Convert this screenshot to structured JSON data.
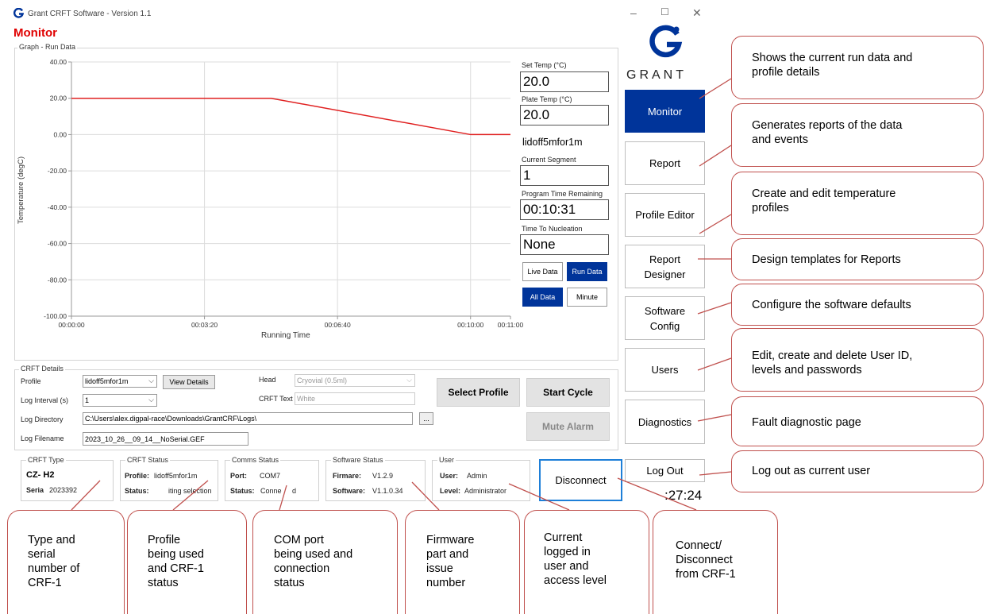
{
  "window": {
    "title": "Grant CRFT Software - Version 1.1",
    "minimize": "–",
    "maximize": "☐",
    "close": "✕"
  },
  "section_title": "Monitor",
  "graph": {
    "group_label": "Graph - Run Data",
    "y_axis_label": "Temperature (degC)",
    "x_axis_label": "Running Time",
    "y_ticks": [
      "40.00",
      "20.00",
      "0.00",
      "-20.00",
      "-40.00",
      "-60.00",
      "-80.00",
      "-100.00"
    ],
    "x_ticks": [
      "00:00:00",
      "00:03:20",
      "00:06:40",
      "00:10:00",
      "00:11:00"
    ]
  },
  "chart_data": {
    "type": "line",
    "xlabel": "Running Time",
    "ylabel": "Temperature (degC)",
    "ylim": [
      -100,
      40
    ],
    "xlim": [
      "00:00:00",
      "00:11:00"
    ],
    "grid": true,
    "series": [
      {
        "color": "#e02020",
        "x": [
          "00:00:00",
          "00:05:00",
          "00:10:00",
          "00:11:00"
        ],
        "y": [
          20,
          20,
          0,
          0
        ]
      }
    ]
  },
  "readouts": {
    "set_temp_label": "Set Temp (°C)",
    "set_temp": "20.0",
    "plate_temp_label": "Plate Temp (°C)",
    "plate_temp": "20.0",
    "profile_name": "lidoff5mfor1m",
    "segment_label": "Current Segment",
    "segment": "1",
    "time_remaining_label": "Program Time Remaining",
    "time_remaining": "00:10:31",
    "nucleation_label": "Time To Nucleation",
    "nucleation": "None",
    "live_data": "Live Data",
    "run_data": "Run Data",
    "all_data": "All Data",
    "minute": "Minute"
  },
  "crft_details": {
    "group_label": "CRFT Details",
    "profile_label": "Profile",
    "profile_value": "lidoff5mfor1m",
    "view_details": "View Details",
    "head_label": "Head",
    "head_value": "Cryovial (0.5ml)",
    "log_interval_label": "Log Interval (s)",
    "log_interval_value": "1",
    "crft_text_label": "CRFT Text",
    "crft_text_placeholder": "White",
    "log_dir_label": "Log Directory",
    "log_dir_value": "C:\\Users\\alex.digpal-race\\Downloads\\GrantCRF\\Logs\\",
    "browse": "...",
    "log_filename_label": "Log Filename",
    "log_filename_value": "2023_10_26__09_14__NoSerial.GEF",
    "select_profile": "Select Profile",
    "start_cycle": "Start Cycle",
    "mute_alarm": "Mute Alarm"
  },
  "status": {
    "type_title": "CRFT Type",
    "type_value": "CZ- H2",
    "serial_label": "Seria",
    "serial_value": "2023392",
    "crft_status_title": "CRFT Status",
    "profile_key": "Profile:",
    "profile_val": "lidoff5mfor1m",
    "status_key": "Status:",
    "status_val": "iting selection",
    "comms_title": "Comms Status",
    "port_key": "Port:",
    "port_val": "COM7",
    "comms_status_key": "Status:",
    "comms_status_val": "Conne",
    "comms_status_tail": "d",
    "software_title": "Software Status",
    "firmware_key": "Firmare:",
    "firmware_val": "V1.2.9",
    "software_key": "Software:",
    "software_val": "V1.1.0.34",
    "user_title": "User",
    "user_key": "User:",
    "user_val": "Admin",
    "level_key": "Level:",
    "level_val": "Administrator",
    "disconnect": "Disconnect",
    "clock": ":27:24"
  },
  "sidebar": {
    "logo_text": "GRANT",
    "items": [
      {
        "line1": "Monitor",
        "line2": ""
      },
      {
        "line1": "Report",
        "line2": ""
      },
      {
        "line1": "Profile Editor",
        "line2": ""
      },
      {
        "line1": "Report",
        "line2": "Designer"
      },
      {
        "line1": "Software",
        "line2": "Config"
      },
      {
        "line1": "Users",
        "line2": ""
      },
      {
        "line1": "Diagnostics",
        "line2": ""
      },
      {
        "line1": "Log Out",
        "line2": ""
      }
    ]
  },
  "callouts": {
    "right": [
      {
        "l1": "Shows the current run data and",
        "l2": "profile details"
      },
      {
        "l1": "Generates reports of the data",
        "l2": "and events"
      },
      {
        "l1": "Create and edit temperature",
        "l2": "profiles"
      },
      {
        "l1": "Design templates for Reports",
        "l2": ""
      },
      {
        "l1": "Configure the software defaults",
        "l2": ""
      },
      {
        "l1": "Edit, create and delete User ID,",
        "l2": "levels and passwords"
      },
      {
        "l1": "Fault diagnostic page",
        "l2": ""
      },
      {
        "l1": "Log out as current user",
        "l2": ""
      }
    ],
    "bottom": [
      {
        "lines": [
          "Type and",
          "serial",
          "number of",
          "CRF-1"
        ]
      },
      {
        "lines": [
          "Profile",
          "being used",
          "and CRF-1",
          "status"
        ]
      },
      {
        "lines": [
          "COM port",
          "being used and",
          "connection",
          "status"
        ]
      },
      {
        "lines": [
          "Firmware",
          "part and",
          "issue",
          "number"
        ]
      },
      {
        "lines": [
          "Current",
          "logged in",
          "user and",
          "access level"
        ]
      },
      {
        "lines": [
          "Connect/",
          "Disconnect",
          "from CRF-1"
        ]
      }
    ]
  },
  "colors": {
    "accent": "#00349a",
    "monitor_title": "#e00000",
    "series": "#e02020",
    "callout_border": "#c0504d"
  }
}
